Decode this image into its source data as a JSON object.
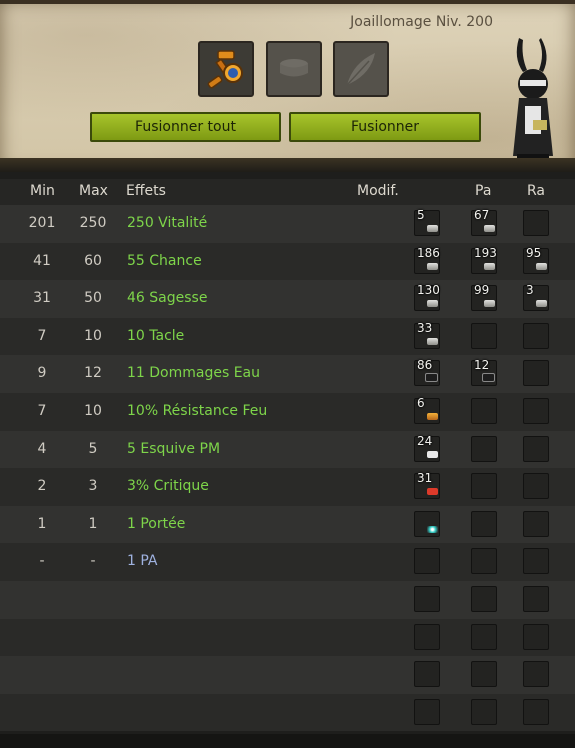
{
  "craft": {
    "title": "Joaillomage Niv. 200"
  },
  "buttons": {
    "merge_all": "Fusionner tout",
    "merge": "Fusionner"
  },
  "table": {
    "headers": {
      "min": "Min",
      "max": "Max",
      "effects": "Effets",
      "modif": "Modif.",
      "pa": "Pa",
      "ra": "Ra"
    },
    "rows": [
      {
        "min": "201",
        "max": "250",
        "effect": "250 Vitalité",
        "rune": "5",
        "pa": "67",
        "ra": ""
      },
      {
        "min": "41",
        "max": "60",
        "effect": "55 Chance",
        "rune": "186",
        "pa": "193",
        "ra": "95"
      },
      {
        "min": "31",
        "max": "50",
        "effect": "46 Sagesse",
        "rune": "130",
        "pa": "99",
        "ra": "3"
      },
      {
        "min": "7",
        "max": "10",
        "effect": "10 Tacle",
        "rune": "33",
        "pa": "",
        "ra": ""
      },
      {
        "min": "9",
        "max": "12",
        "effect": "11 Dommages Eau",
        "rune": "86",
        "pa": "12",
        "ra": ""
      },
      {
        "min": "7",
        "max": "10",
        "effect": "10% Résistance Feu",
        "rune": "6",
        "pa": "",
        "ra": ""
      },
      {
        "min": "4",
        "max": "5",
        "effect": "5 Esquive PM",
        "rune": "24",
        "pa": "",
        "ra": ""
      },
      {
        "min": "2",
        "max": "3",
        "effect": "3% Critique",
        "rune": "31",
        "pa": "",
        "ra": ""
      },
      {
        "min": "1",
        "max": "1",
        "effect": "1 Portée",
        "rune": "",
        "pa": "",
        "ra": ""
      },
      {
        "min": "-",
        "max": "-",
        "effect": "1 PA",
        "rune": "",
        "pa": "",
        "ra": ""
      }
    ]
  },
  "colors": {
    "effect_positive": "#7ed54a",
    "effect_neutral": "#9fb2e0",
    "button_green": "#8eab1d"
  }
}
